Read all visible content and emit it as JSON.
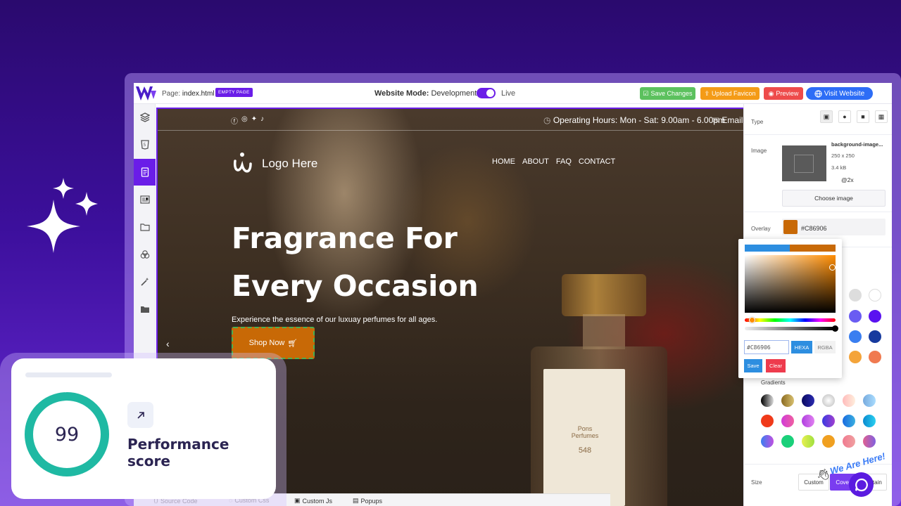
{
  "topbar": {
    "page_prefix": "Page:",
    "page_name": "index.html",
    "page_badge": "EMPTY PAGE",
    "mode_label": "Website Mode:",
    "mode_value": "Development",
    "live_label": "Live",
    "save_label": "Save Changes",
    "upload_label": "Upload Favicon",
    "preview_label": "Preview",
    "visit_label": "Visit Website"
  },
  "rail": {
    "items": [
      "layers-icon",
      "html5-icon",
      "page-icon",
      "news-icon",
      "folder-open-icon",
      "circles-icon",
      "magic-wand-icon",
      "folder-icon"
    ],
    "active_index": 2
  },
  "site": {
    "hours": "Operating Hours: Mon - Sat: 9.00am - 6.00pm",
    "email": "Email:",
    "logo_text": "Logo Here",
    "nav": [
      "HOME",
      "ABOUT",
      "FAQ",
      "CONTACT"
    ],
    "hero_line1": "Fragrance For",
    "hero_line2": "Every Occasion",
    "hero_sub": "Experience the essence of our luxuay perfumes for all ages.",
    "shop_label": "Shop Now",
    "bottle_brand": "Pons Perfumes",
    "bottle_num": "548"
  },
  "panel": {
    "type_label": "Type",
    "image_label": "Image",
    "image_name": "background-image...",
    "image_dims": "250 x 250",
    "image_size": "3.4 kB",
    "image_scale": "@2x",
    "choose_label": "Choose image",
    "overlay_label": "Overlay",
    "overlay_value": "#C86906",
    "overlay_color": "#c86906",
    "gradients_label": "Gradients",
    "size_label": "Size",
    "size_custom": "Custom",
    "size_cover": "Cover",
    "size_contain": "Contain"
  },
  "picker": {
    "hex_value": "#C86906",
    "hexa_label": "HEXA",
    "rgba_label": "RGBA",
    "save_label": "Save",
    "clear_label": "Clear"
  },
  "bottom_tabs": {
    "source": "Source Code",
    "css": "Custom Css",
    "js": "Custom Js",
    "popups": "Popups"
  },
  "performance": {
    "score": "99",
    "score_fraction": 0.99,
    "label": "Performance score",
    "ring_color": "#1fb9a3"
  },
  "chat": {
    "label": "We Are Here!"
  }
}
